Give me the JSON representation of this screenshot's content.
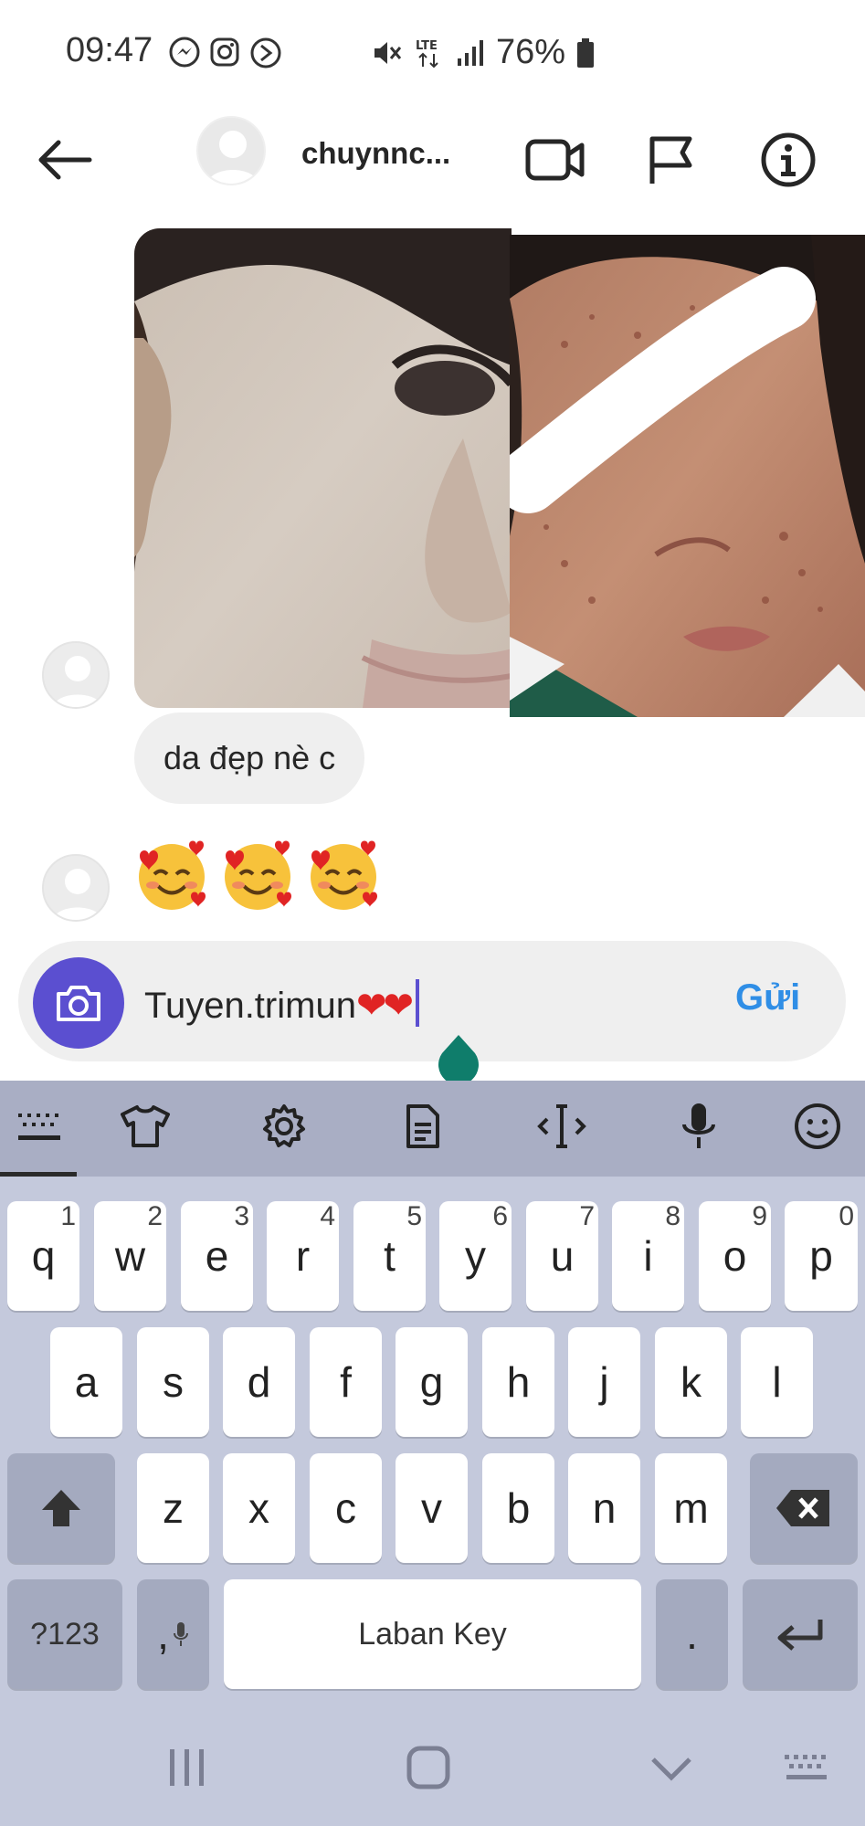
{
  "status_bar": {
    "time": "09:47",
    "battery": "76%",
    "network": "LTE"
  },
  "header": {
    "username": "chuynnc..."
  },
  "messages": {
    "text_bubble": "da đẹp nè c",
    "emoji_reaction": "🥰🥰🥰"
  },
  "composer": {
    "text": "Tuyen.trimun",
    "hearts": "❤❤",
    "send_label": "Gửi"
  },
  "keyboard": {
    "row1": [
      {
        "key": "q",
        "hint": "1"
      },
      {
        "key": "w",
        "hint": "2"
      },
      {
        "key": "e",
        "hint": "3"
      },
      {
        "key": "r",
        "hint": "4"
      },
      {
        "key": "t",
        "hint": "5"
      },
      {
        "key": "y",
        "hint": "6"
      },
      {
        "key": "u",
        "hint": "7"
      },
      {
        "key": "i",
        "hint": "8"
      },
      {
        "key": "o",
        "hint": "9"
      },
      {
        "key": "p",
        "hint": "0"
      }
    ],
    "row2": [
      "a",
      "s",
      "d",
      "f",
      "g",
      "h",
      "j",
      "k",
      "l"
    ],
    "row3": [
      "z",
      "x",
      "c",
      "v",
      "b",
      "n",
      "m"
    ],
    "symbols_label": "?123",
    "comma_label": ",",
    "space_label": "Laban Key",
    "period_label": "."
  },
  "colors": {
    "accent_purple": "#5b4fd0",
    "send_blue": "#2f8ee6",
    "keyboard_bg": "#c4c9dc",
    "heart_red": "#e02424",
    "handle_teal": "#0f7d6b"
  }
}
